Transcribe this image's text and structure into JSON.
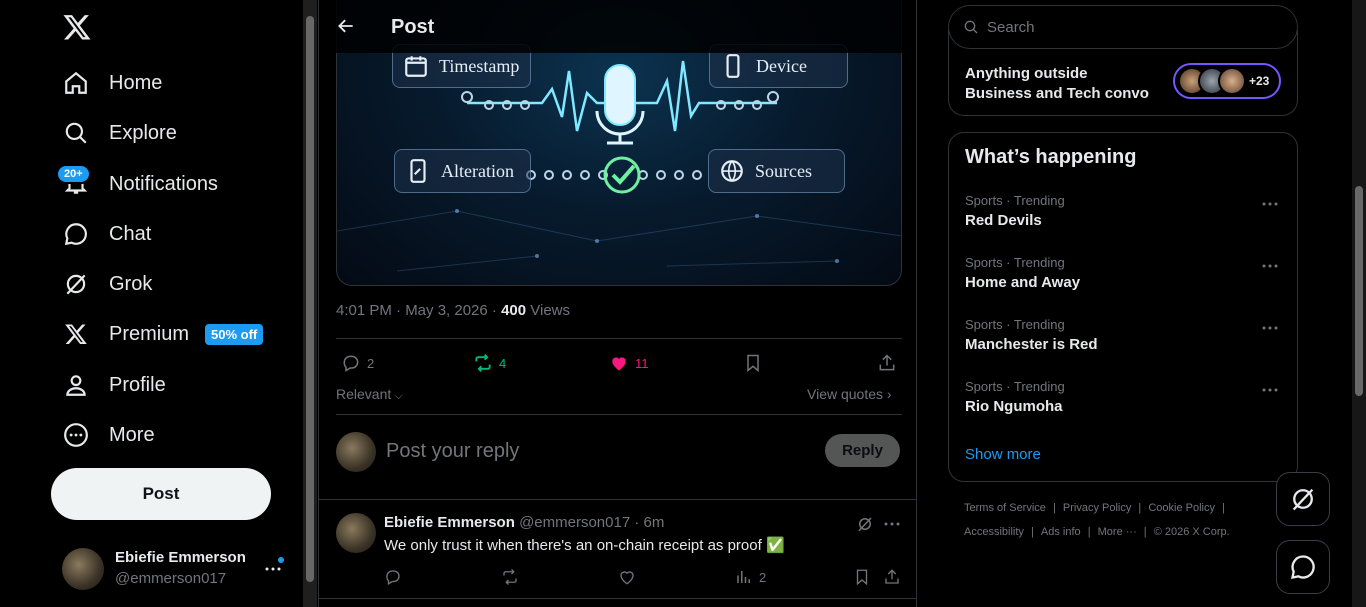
{
  "nav": {
    "home": "Home",
    "explore": "Explore",
    "notifications": "Notifications",
    "notifications_badge": "20+",
    "chat": "Chat",
    "grok": "Grok",
    "premium": "Premium",
    "premium_badge": "50% off",
    "profile": "Profile",
    "more": "More",
    "post_button": "Post"
  },
  "account": {
    "name": "Ebiefie Emmerson",
    "handle": "@emmerson017"
  },
  "header": {
    "title": "Post"
  },
  "media": {
    "chips": [
      "Timestamp",
      "Device",
      "Alteration",
      "Sources"
    ]
  },
  "post": {
    "time": "4:01 PM · May 3, 2026 · ",
    "views_count": "400",
    "views_label": " Views",
    "replies": "2",
    "reposts": "4",
    "likes": "11"
  },
  "sort": {
    "relevant": "Relevant",
    "view_quotes": "View quotes"
  },
  "compose": {
    "placeholder": "Post your reply",
    "reply_button": "Reply"
  },
  "reply": {
    "name": "Ebiefie Emmerson",
    "handle_time": "@emmerson017 · 6m",
    "text": "We only trust it when there's an on-chain receipt as proof ✅",
    "views": "2"
  },
  "search": {
    "placeholder": "Search"
  },
  "community": {
    "title_line1": "Anything outside",
    "title_line2": "Business and Tech convo",
    "member_count": "+23"
  },
  "happening": {
    "title": "What’s happening",
    "trends": [
      {
        "category": "Sports · Trending",
        "name": "Red Devils"
      },
      {
        "category": "Sports · Trending",
        "name": "Home and Away"
      },
      {
        "category": "Sports · Trending",
        "name": "Manchester is Red"
      },
      {
        "category": "Sports · Trending",
        "name": "Rio Ngumoha"
      }
    ],
    "show_more": "Show more"
  },
  "footer": {
    "terms": "Terms of Service",
    "privacy": "Privacy Policy",
    "cookie": "Cookie Policy",
    "accessibility": "Accessibility",
    "ads": "Ads info",
    "more": "More ···",
    "copyright": "© 2026 X Corp."
  },
  "colors": {
    "accent": "#1d9bf0",
    "like": "#f91880",
    "repost": "#00ba7c",
    "text_secondary": "#71767b"
  }
}
